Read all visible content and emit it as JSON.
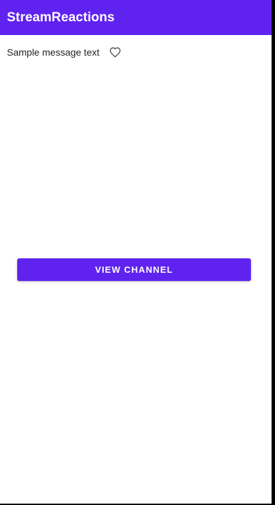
{
  "app_bar": {
    "title": "StreamReactions",
    "color": "#6023EF"
  },
  "message": {
    "text": "Sample message text",
    "reaction_icon": "heart-outline-icon"
  },
  "actions": {
    "view_channel_label": "VIEW CHANNEL",
    "button_color": "#6023EF"
  }
}
